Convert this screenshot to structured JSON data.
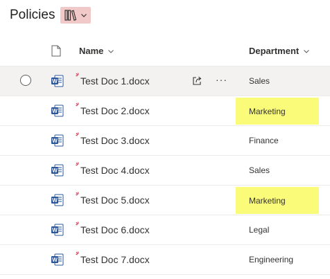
{
  "library": {
    "title": "Policies"
  },
  "header": {
    "name_label": "Name",
    "department_label": "Department"
  },
  "rows": [
    {
      "name": "Test Doc 1.docx",
      "department": "Sales",
      "highlight": false,
      "selected": true
    },
    {
      "name": "Test Doc 2.docx",
      "department": "Marketing",
      "highlight": true,
      "selected": false
    },
    {
      "name": "Test Doc 3.docx",
      "department": "Finance",
      "highlight": false,
      "selected": false
    },
    {
      "name": "Test Doc 4.docx",
      "department": "Sales",
      "highlight": false,
      "selected": false
    },
    {
      "name": "Test Doc 5.docx",
      "department": "Marketing",
      "highlight": true,
      "selected": false
    },
    {
      "name": "Test Doc 6.docx",
      "department": "Legal",
      "highlight": false,
      "selected": false
    },
    {
      "name": "Test Doc 7.docx",
      "department": "Engineering",
      "highlight": false,
      "selected": false
    }
  ],
  "row_actions": {
    "more_glyph": "···"
  },
  "colors": {
    "highlight": "#fbfb7a",
    "view_switch_bg": "#f2c9c9",
    "word_blue": "#2b579a",
    "new_mark": "#c4314b"
  },
  "icons": {
    "view_switch": "library-books-icon",
    "file_type_header": "document-icon",
    "file_type": "word-icon",
    "new_item": "new-item-sparkle-icon",
    "share": "share-icon",
    "more": "more-options-icon",
    "sort": "chevron-down-icon"
  }
}
